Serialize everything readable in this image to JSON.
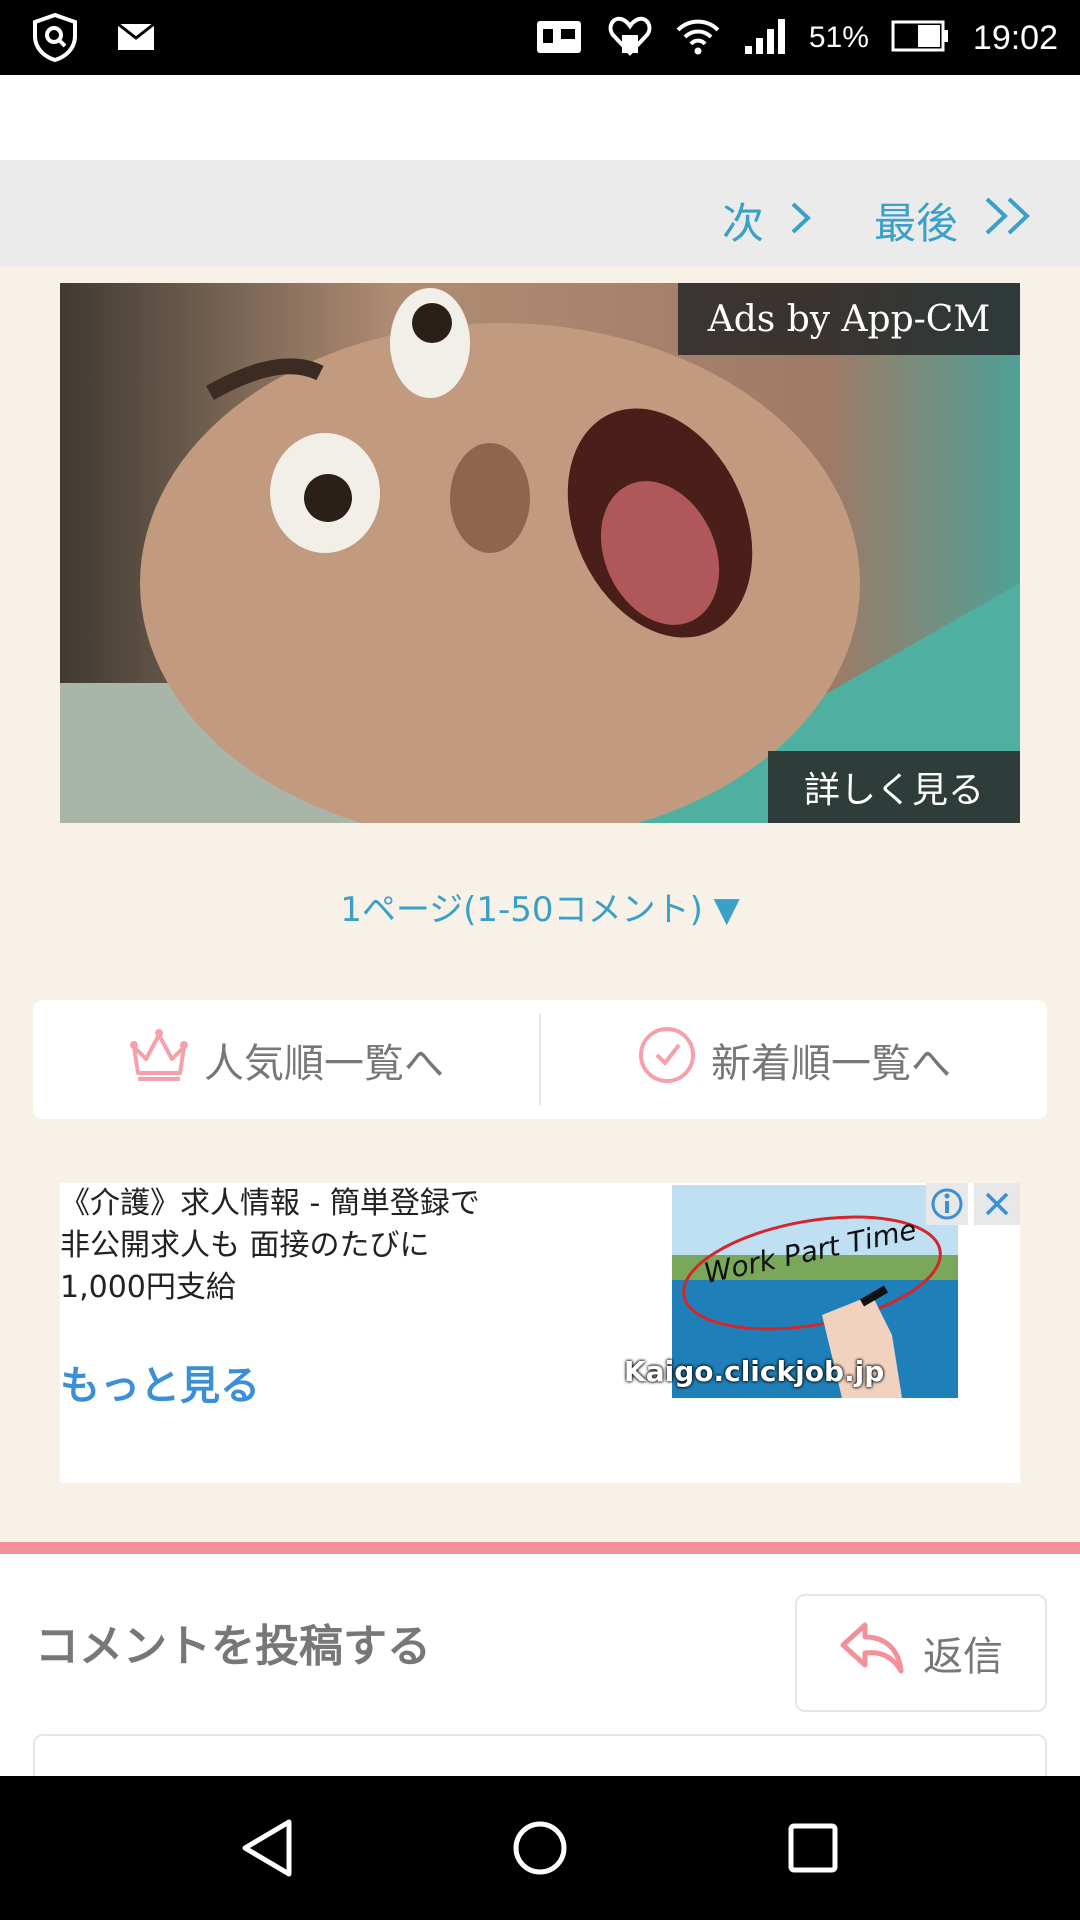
{
  "status_bar": {
    "battery": "51%",
    "time": "19:02",
    "icons": [
      "shield-icon",
      "mail-icon",
      "nfc-icon",
      "heart-download-icon",
      "wifi-icon",
      "signal-icon",
      "battery-icon"
    ]
  },
  "pager": {
    "next_label": "次",
    "last_label": "最後"
  },
  "video_ad": {
    "ads_by": "Ads by App-CM",
    "details_label": "詳しく見る"
  },
  "page_select": {
    "label": "1ページ(1-50コメント) ▼"
  },
  "sort": {
    "popular_label": "人気順一覧へ",
    "newest_label": "新着順一覧へ"
  },
  "text_ad": {
    "line1": "《介護》求人情報 - 簡単登録で",
    "line2": "非公開求人も 面接のたびに",
    "line3": "1,000円支給",
    "more_label": "もっと見る",
    "domain": "Kaigo.clickjob.jp",
    "image_text": "Work Part Time"
  },
  "comment": {
    "title": "コメントを投稿する",
    "reply_label": "返信"
  },
  "colors": {
    "accent_blue": "#3aa0c8",
    "pink": "#f4909a",
    "page_bg": "#f8f1e8"
  }
}
